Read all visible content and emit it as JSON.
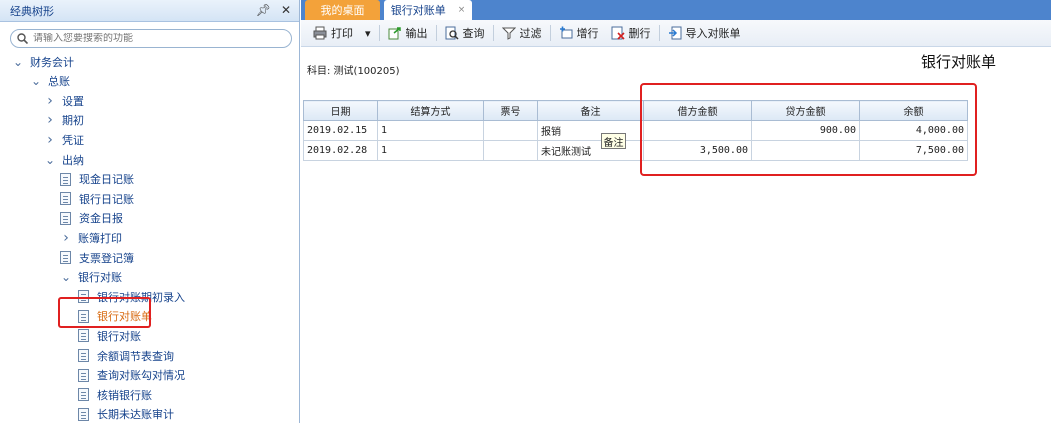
{
  "left_panel": {
    "title": "经典树形",
    "pin_icon": "pin-icon",
    "close_icon": "close-icon",
    "search_placeholder": "请输入您要搜索的功能",
    "tree": [
      {
        "label": "财务会计",
        "level": 0,
        "type": "expanded"
      },
      {
        "label": "总账",
        "level": 1,
        "type": "expanded"
      },
      {
        "label": "设置",
        "level": 2,
        "type": "collapsed"
      },
      {
        "label": "期初",
        "level": 2,
        "type": "collapsed"
      },
      {
        "label": "凭证",
        "level": 2,
        "type": "collapsed"
      },
      {
        "label": "出纳",
        "level": 2,
        "type": "expanded"
      },
      {
        "label": "现金日记账",
        "level": 3,
        "type": "leaf"
      },
      {
        "label": "银行日记账",
        "level": 3,
        "type": "leaf"
      },
      {
        "label": "资金日报",
        "level": 3,
        "type": "leaf"
      },
      {
        "label": "账簿打印",
        "level": 3,
        "type": "collapsed"
      },
      {
        "label": "支票登记簿",
        "level": 3,
        "type": "leaf"
      },
      {
        "label": "银行对账",
        "level": 3,
        "type": "expanded"
      },
      {
        "label": "银行对账期初录入",
        "level": 4,
        "type": "leaf"
      },
      {
        "label": "银行对账单",
        "level": 4,
        "type": "leaf",
        "selected": true
      },
      {
        "label": "银行对账",
        "level": 4,
        "type": "leaf"
      },
      {
        "label": "余额调节表查询",
        "level": 4,
        "type": "leaf"
      },
      {
        "label": "查询对账勾对情况",
        "level": 4,
        "type": "leaf"
      },
      {
        "label": "核销银行账",
        "level": 4,
        "type": "leaf"
      },
      {
        "label": "长期未达账审计",
        "level": 4,
        "type": "leaf"
      }
    ]
  },
  "tabs": {
    "home": "我的桌面",
    "active": "银行对账单",
    "close": "×"
  },
  "toolbar": {
    "print": "打印",
    "dropdown": "▾",
    "export": "输出",
    "query": "查询",
    "filter": "过滤",
    "add_row": "增行",
    "delete_row": "删行",
    "import": "导入对账单"
  },
  "subject": "科目: 测试(100205)",
  "report_title": "银行对账单",
  "table": {
    "headers": [
      "日期",
      "结算方式",
      "票号",
      "备注",
      "借方金额",
      "贷方金额",
      "余额"
    ],
    "rows": [
      [
        "2019.02.15",
        "1",
        "",
        "报销",
        "",
        "900.00",
        "4,000.00"
      ],
      [
        "2019.02.28",
        "1",
        "",
        "未记账测试",
        "3,500.00",
        "",
        "7,500.00"
      ]
    ]
  },
  "tooltip": "备注",
  "colors": {
    "tab_bar": "#4d84cd",
    "home_tab": "#f3a23a",
    "highlight": "#e02020",
    "tree_text": "#15428b"
  }
}
